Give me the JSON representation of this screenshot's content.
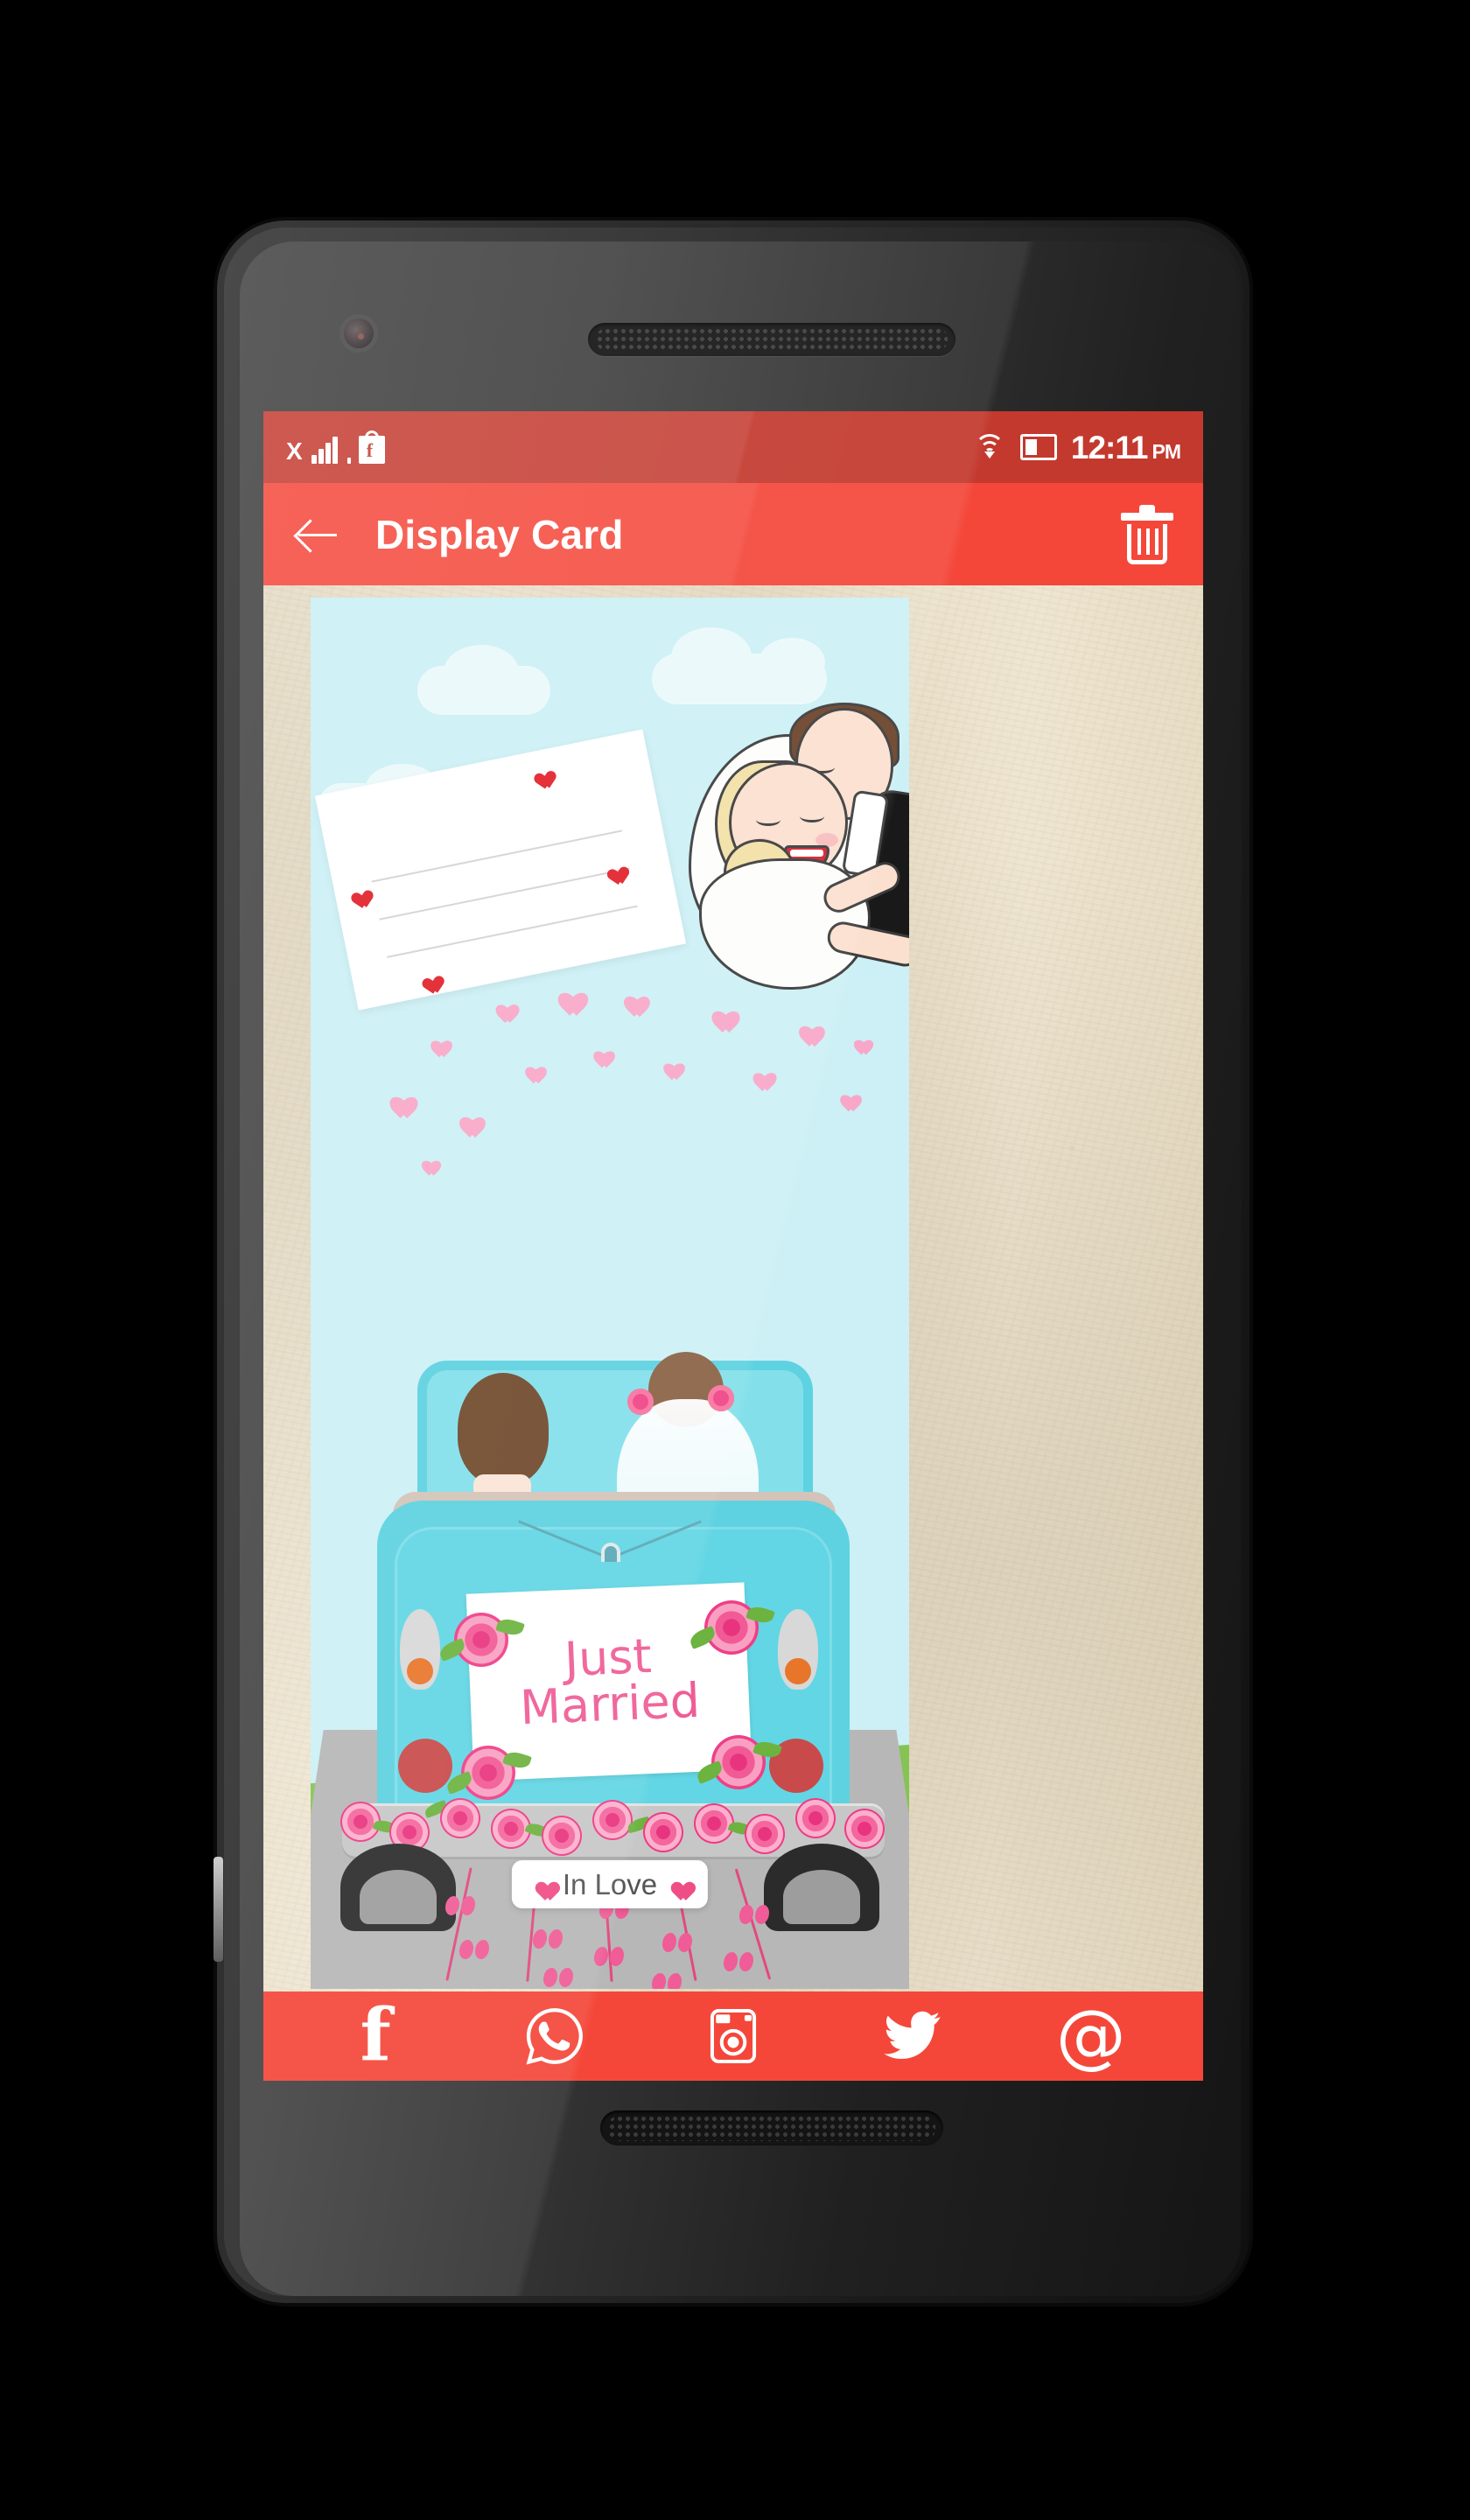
{
  "statusbar": {
    "network_label": "X",
    "signal_icon": "signal-bars-icon",
    "app_icon": "flipkart-notification-icon",
    "wifi_icon": "wifi-icon",
    "battery_icon": "battery-icon",
    "time": "12:11",
    "meridiem": "PM"
  },
  "appbar": {
    "back_icon": "back-arrow-icon",
    "title": "Display Card",
    "delete_icon": "trash-icon",
    "bg_color": "#f4473a"
  },
  "card": {
    "sign_line1": "Just",
    "sign_line2": "Married",
    "badge_text": "In Love",
    "badge_heart": "♥",
    "scene_colors": {
      "sky": "#ccf0f5",
      "grass": "#85c354",
      "road": "#b7b7b7",
      "car": "#5ed2e0",
      "rose": "#e8347e",
      "heart_pink": "#f9a7c8",
      "heart_red": "#e2202a",
      "parchment": "#ece3ce"
    }
  },
  "social": {
    "items": [
      {
        "name": "facebook-share-button",
        "glyph": "f"
      },
      {
        "name": "whatsapp-share-button",
        "glyph": ""
      },
      {
        "name": "instagram-share-button",
        "glyph": ""
      },
      {
        "name": "twitter-share-button",
        "glyph": ""
      },
      {
        "name": "email-share-button",
        "glyph": "@"
      }
    ],
    "bg_color": "#f4473a"
  },
  "device": {
    "camera_icon": "front-camera",
    "earpiece_icon": "earpiece-speaker",
    "bottom_speaker_icon": "bottom-speaker",
    "power_button": "power-button",
    "volume_button": "volume-button",
    "left_button": "left-side-button"
  }
}
